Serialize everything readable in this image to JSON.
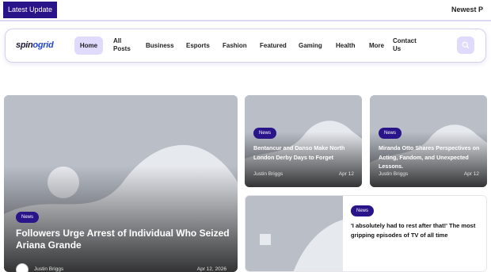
{
  "ticker": {
    "label": "Latest Update",
    "text": "Newest P"
  },
  "header": {
    "logo_left": "spin",
    "logo_right": "ogrid",
    "nav": [
      {
        "label": "Home"
      },
      {
        "label": "All\nPosts"
      },
      {
        "label": "Business"
      },
      {
        "label": "Esports"
      },
      {
        "label": "Fashion"
      },
      {
        "label": "Featured"
      },
      {
        "label": "Gaming"
      },
      {
        "label": "Health"
      },
      {
        "label": "More"
      },
      {
        "label": "Contact\nUs"
      }
    ]
  },
  "posts": {
    "hero": {
      "category": "News",
      "title": "Followers Urge Arrest of Individual Who Seized Ariana Grande",
      "author": "Justin Briggs",
      "date": "Apr 12, 2026"
    },
    "card2": {
      "category": "News",
      "title": "Bentancur and Danso Make North London Derby Days to Forget",
      "author": "Justin Briggs",
      "date": "Apr 12"
    },
    "card3": {
      "category": "News",
      "title": "Miranda Otto Shares Perspectives on Acting, Fandom, and Unexpected Lessons.",
      "author": "Justin Briggs",
      "date": "Apr 12"
    },
    "card4": {
      "category": "News",
      "title": "'I absolutely had to rest after that!' The most gripping episodes of TV of all time"
    }
  },
  "colors": {
    "accent": "#2a148a",
    "nav_highlight": "#e0dafc",
    "placeholder": "#b9bec7"
  }
}
